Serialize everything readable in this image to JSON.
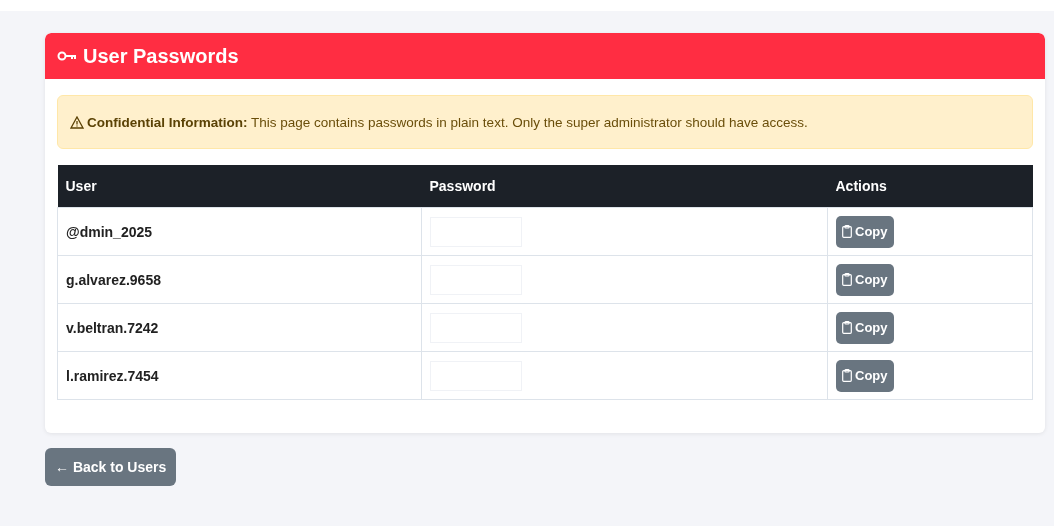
{
  "card": {
    "title": "User Passwords"
  },
  "alert": {
    "text": "**Confidential Information:** This page contains passwords in plain text. Only the super administrator should have access."
  },
  "table": {
    "columns": [
      "User",
      "Password",
      "Actions"
    ],
    "rows": [
      {
        "user": "@dmin_2025",
        "action": "Copy"
      },
      {
        "user": "g.alvarez.9658",
        "action": "Copy"
      },
      {
        "user": "v.beltran.7242",
        "action": "Copy"
      },
      {
        "user": "l.ramirez.7454",
        "action": "Copy"
      }
    ]
  },
  "back_button": "← Back to Users"
}
